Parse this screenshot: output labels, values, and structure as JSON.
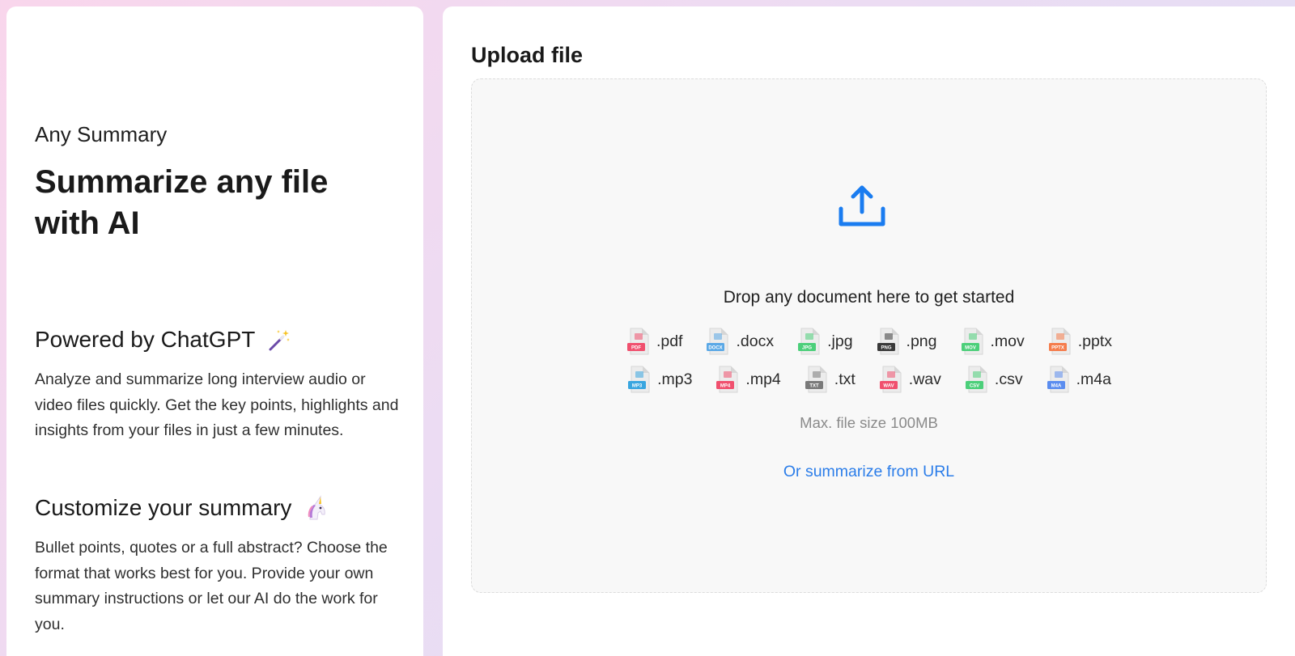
{
  "intro": {
    "app_name": "Any Summary",
    "headline": "Summarize any file with AI"
  },
  "features": [
    {
      "title": "Powered by ChatGPT",
      "icon": "magic-wand-icon",
      "description": "Analyze and summarize long interview audio or video files quickly. Get the key points, highlights and insights from your files in just a few minutes."
    },
    {
      "title": "Customize your summary",
      "icon": "unicorn-icon",
      "description": "Bullet points, quotes or a full abstract? Choose the format that works best for you. Provide your own summary instructions or let our AI do the work for you."
    }
  ],
  "upload": {
    "title": "Upload file",
    "drop_text": "Drop any document here to get started",
    "max_size": "Max. file size 100MB",
    "url_link": "Or summarize from URL",
    "accent_color": "#1a7cf0",
    "file_types_row1": [
      {
        "ext": ".pdf",
        "badge": "PDF",
        "color": "#f0506e",
        "icon": "pdf-file-icon"
      },
      {
        "ext": ".docx",
        "badge": "DOCX",
        "color": "#5aa8e6",
        "icon": "docx-file-icon"
      },
      {
        "ext": ".jpg",
        "badge": "JPG",
        "color": "#4ccf7a",
        "icon": "jpg-file-icon"
      },
      {
        "ext": ".png",
        "badge": "PNG",
        "color": "#3a3a3a",
        "icon": "png-file-icon"
      },
      {
        "ext": ".mov",
        "badge": "MOV",
        "color": "#4ccf7a",
        "icon": "mov-file-icon"
      },
      {
        "ext": ".pptx",
        "badge": "PPTX",
        "color": "#f57c4b",
        "icon": "pptx-file-icon"
      }
    ],
    "file_types_row2": [
      {
        "ext": ".mp3",
        "badge": "MP3",
        "color": "#39a6e0",
        "icon": "mp3-file-icon"
      },
      {
        "ext": ".mp4",
        "badge": "MP4",
        "color": "#f0506e",
        "icon": "mp4-file-icon"
      },
      {
        "ext": ".txt",
        "badge": "TXT",
        "color": "#7a7a7a",
        "icon": "txt-file-icon"
      },
      {
        "ext": ".wav",
        "badge": "WAV",
        "color": "#f0506e",
        "icon": "wav-file-icon"
      },
      {
        "ext": ".csv",
        "badge": "CSV",
        "color": "#4ccf7a",
        "icon": "csv-file-icon"
      },
      {
        "ext": ".m4a",
        "badge": "M4A",
        "color": "#5b8def",
        "icon": "m4a-file-icon"
      }
    ]
  }
}
